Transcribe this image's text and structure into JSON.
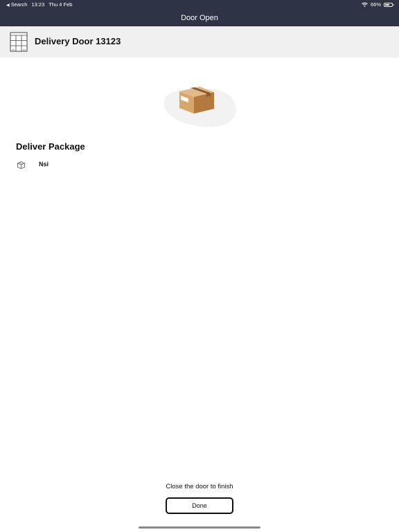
{
  "status_bar": {
    "back_label": "Search",
    "time": "13:23",
    "date": "Thu 4 Feb",
    "battery": "66%",
    "battery_level": 0.66,
    "wifi_icon": "wifi-icon",
    "battery_icon": "battery-icon"
  },
  "nav": {
    "title": "Door Open"
  },
  "door": {
    "title": "Delivery Door 13123",
    "icon": "locker-icon"
  },
  "illustration": {
    "icon": "package-box-icon"
  },
  "section": {
    "title": "Deliver Package",
    "items": [
      {
        "icon": "package-icon",
        "label": "Nsi"
      }
    ]
  },
  "footer": {
    "instruction": "Close the door to finish",
    "done_label": "Done"
  }
}
